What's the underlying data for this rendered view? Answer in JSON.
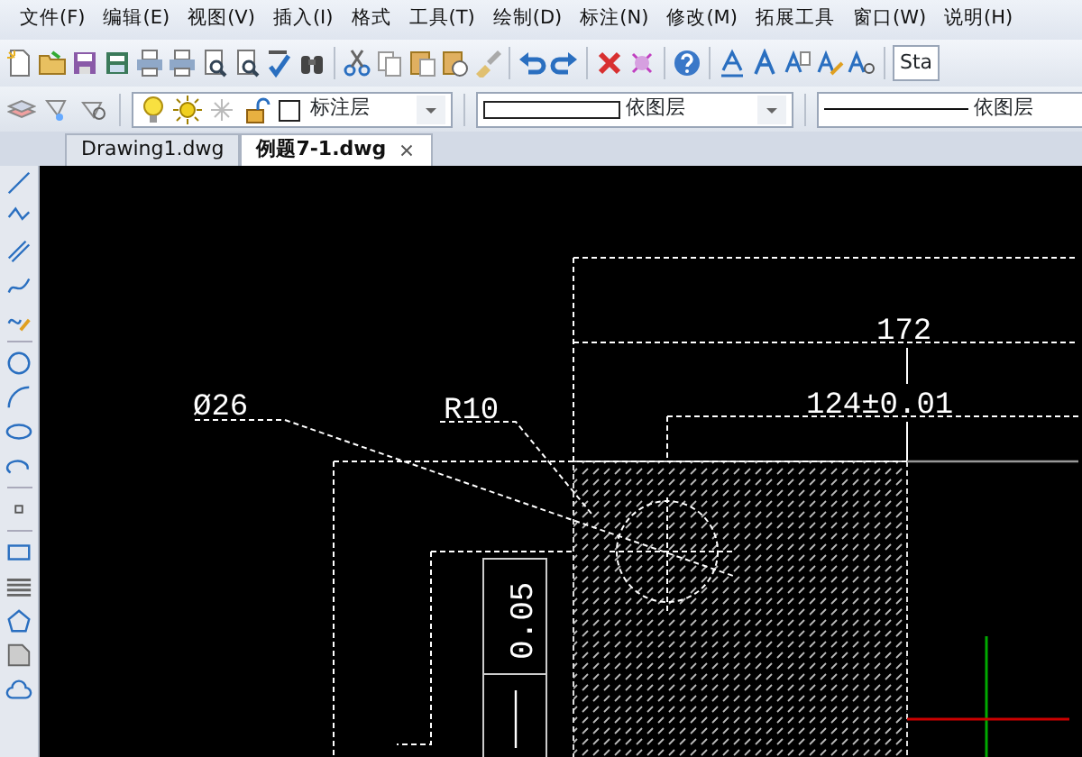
{
  "menu": [
    "文件(F)",
    "编辑(E)",
    "视图(V)",
    "插入(I)",
    "格式",
    "工具(T)",
    "绘制(D)",
    "标注(N)",
    "修改(M)",
    "拓展工具",
    "窗口(W)",
    "说明(H)"
  ],
  "text_style_combo": {
    "value": "Sta"
  },
  "layer_combo": {
    "value": "标注层"
  },
  "color_combo": {
    "value": "依图层"
  },
  "linetype_combo": {
    "value": "依图层"
  },
  "tabs": [
    {
      "label": "Drawing1.dwg",
      "selected": false
    },
    {
      "label": "例题7-1.dwg",
      "selected": true
    }
  ],
  "drawing": {
    "annotations": [
      {
        "kind": "dimension",
        "text": "Ø26"
      },
      {
        "kind": "dimension",
        "text": "R10"
      },
      {
        "kind": "dimension",
        "text": "172"
      },
      {
        "kind": "dimension",
        "text": "124±0.01"
      },
      {
        "kind": "tolerance",
        "text": "0.05"
      }
    ]
  }
}
